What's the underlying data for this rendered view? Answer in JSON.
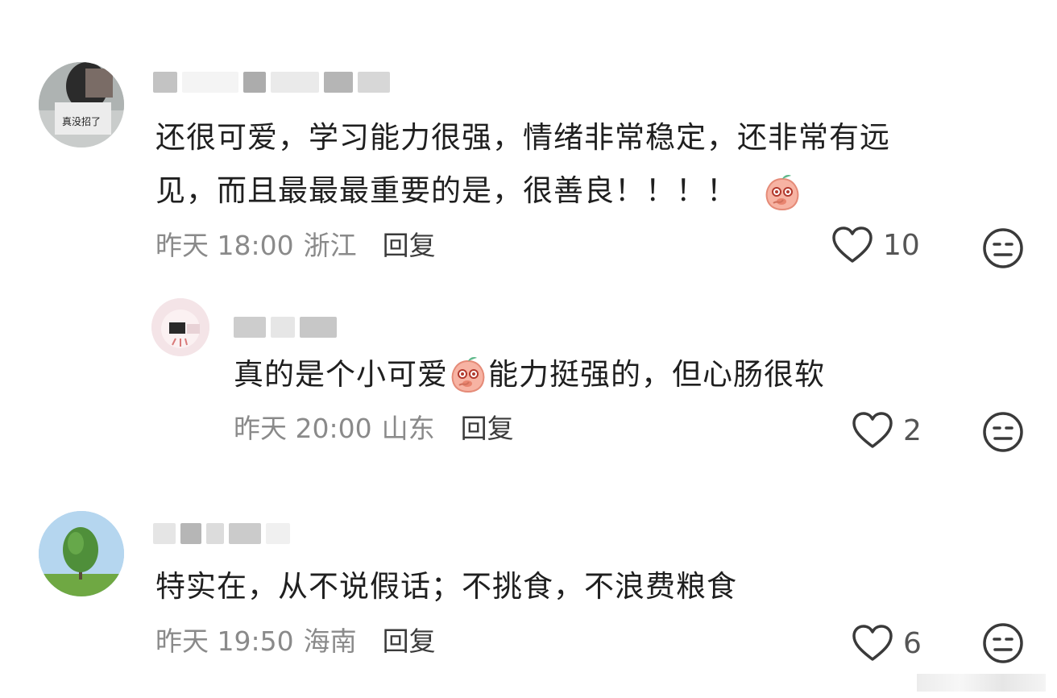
{
  "comments": [
    {
      "content_line1": "还很可爱，学习能力很强，情绪非常稳定，还非常有远",
      "content_line2": "见，而且最最最重要的是，很善良！！！！",
      "time": "昨天 18:00",
      "location": "浙江",
      "reply_label": "回复",
      "likes": "10",
      "avatar_caption": "真没招了",
      "emoji": "blushing-peach-emoji"
    },
    {
      "content_part1": "真的是个小可爱",
      "content_part2": "能力挺强的，但心肠很软",
      "time": "昨天 20:00",
      "location": "山东",
      "reply_label": "回复",
      "likes": "2",
      "emoji": "blushing-peach-emoji"
    },
    {
      "content_line1": "特实在，从不说假话；不挑食，不浪费粮食",
      "time": "昨天 19:50",
      "location": "海南",
      "reply_label": "回复",
      "likes": "6"
    }
  ],
  "icons": {
    "like": "heart-outline-icon",
    "dislike": "meh-face-icon"
  },
  "colors": {
    "text": "#1f1f1f",
    "meta": "#8a8a8a",
    "icon": "#3a3a3a"
  }
}
